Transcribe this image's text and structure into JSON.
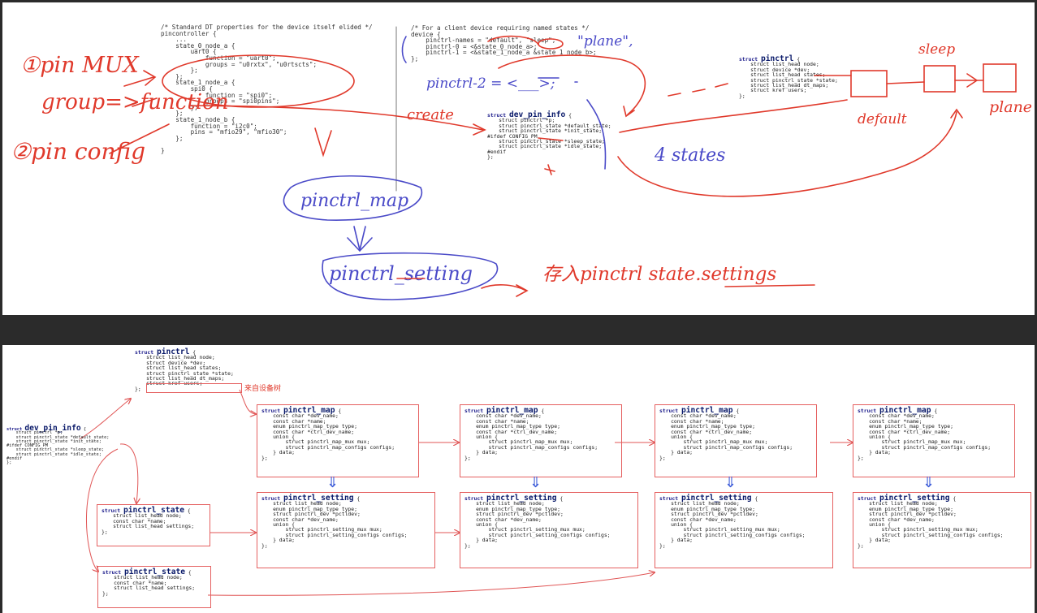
{
  "top": {
    "dts_left": [
      "/* Standard DT properties for the device itself elided */",
      "pincontroller {",
      "    ...",
      "    state_0_node_a {",
      "        uart0 {",
      "            function = \"uart0\";",
      "            groups = \"u0rxtx\", \"u0rtscts\";",
      "        };",
      "    };",
      "    state_1_node_a {",
      "        spi0 {",
      "            function = \"spi0\";",
      "            groups = \"spi0pins\";",
      "        };",
      "    };",
      "    state_1_node_b {",
      "        function = \"i2c0\";",
      "        pins = \"mfio29\", \"mfio30\";",
      "    };",
      "",
      "}"
    ],
    "dts_right": [
      "/* For a client device requiring named states */",
      "device {",
      "    pinctrl-names = \"default\", \"sleep\";",
      "    pinctrl-0 = <&state_0_node_a>;",
      "    pinctrl-1 = <&state_1_node_a &state_1_node_b>;",
      "};"
    ],
    "dev_pin_info": {
      "name": "dev_pin_info",
      "fields": [
        "struct pinctrl *p;",
        "struct pinctrl_state *default_state;",
        "struct pinctrl_state *init_state;",
        "#ifdef CONFIG_PM",
        "struct pinctrl_state *sleep_state;",
        "struct pinctrl_state *idle_state;",
        "#endif"
      ]
    },
    "pinctrl": {
      "name": "pinctrl",
      "fields": [
        "struct list_head node;",
        "struct device *dev;",
        "struct list_head states;",
        "struct pinctrl_state *state;",
        "struct list_head dt_maps;",
        "struct kref users;"
      ]
    },
    "annotations": {
      "pin_mux": "①pin MUX",
      "group_function": "group=>function",
      "pin_config": "②pin config",
      "pinctrl_2": "pinctrl-2 = <___>;",
      "plane_quote": "\"plane\",",
      "create": "create",
      "four_states": "4 states",
      "sleep": "sleep",
      "default": "default",
      "plane": "plane",
      "pinctrl_map": "pinctrl_map",
      "pinctrl_setting": "pinctrl_setting",
      "store_in": "存入pinctrl state.settings"
    }
  },
  "bottom": {
    "struct_keyword": "struct",
    "pinctrl": {
      "name": "pinctrl",
      "fields": [
        "struct list_head node;",
        "struct device *dev;",
        "struct list_head states;",
        "struct pinctrl_state *state;",
        "struct list_head dt_maps;",
        "struct kref users;"
      ],
      "note": "来自设备树"
    },
    "dev_pin_info": {
      "name": "dev_pin_info",
      "fields": [
        "struct pinctrl *p;",
        "struct pinctrl_state *default_state;",
        "struct pinctrl_state *init_state;",
        "#ifdef CONFIG_PM",
        "struct pinctrl_state *sleep_state;",
        "struct pinctrl_state *idle_state;",
        "#endif"
      ]
    },
    "pinctrl_state": {
      "name": "pinctrl_state",
      "fields": [
        "struct list_head node;",
        "const char *name;",
        "struct list_head settings;"
      ]
    },
    "pinctrl_map": {
      "name": "pinctrl_map",
      "fields": [
        "const char *dev_name;",
        "const char *name;",
        "enum pinctrl_map_type type;",
        "const char *ctrl_dev_name;",
        "union {",
        "    struct pinctrl_map_mux mux;",
        "    struct pinctrl_map_configs configs;",
        "} data;"
      ]
    },
    "pinctrl_setting": {
      "name": "pinctrl_setting",
      "fields": [
        "struct list_head node;",
        "enum pinctrl_map_type type;",
        "struct pinctrl_dev *pctldev;",
        "const char *dev_name;",
        "union {",
        "    struct pinctrl_setting_mux mux;",
        "    struct pinctrl_setting_configs configs;",
        "} data;"
      ]
    },
    "open_brace": "{",
    "close_brace": "};",
    "down_arrow": "⇓"
  }
}
